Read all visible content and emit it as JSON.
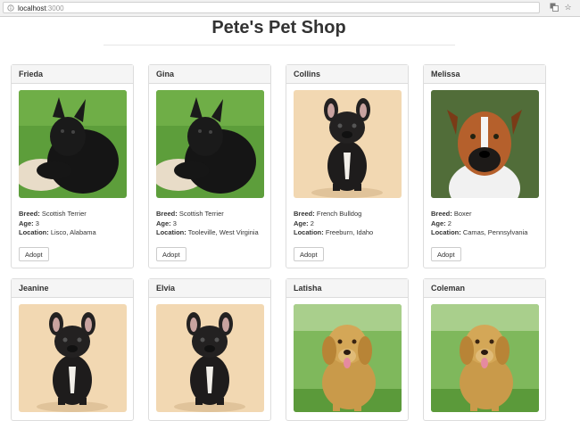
{
  "browser": {
    "url_host": "localhost",
    "url_port": ":3000"
  },
  "page": {
    "title": "Pete's Pet Shop"
  },
  "labels": {
    "breed": "Breed:",
    "age": "Age:",
    "location": "Location:",
    "adopt": "Adopt"
  },
  "pets": [
    {
      "name": "Frieda",
      "breed": "Scottish Terrier",
      "age": "3",
      "location": "Lisco, Alabama",
      "photo": "scottish-terrier"
    },
    {
      "name": "Gina",
      "breed": "Scottish Terrier",
      "age": "3",
      "location": "Tooleville, West Virginia",
      "photo": "scottish-terrier"
    },
    {
      "name": "Collins",
      "breed": "French Bulldog",
      "age": "2",
      "location": "Freeburn, Idaho",
      "photo": "french-bulldog"
    },
    {
      "name": "Melissa",
      "breed": "Boxer",
      "age": "2",
      "location": "Camas, Pennsylvania",
      "photo": "boxer"
    },
    {
      "name": "Jeanine",
      "photo": "french-bulldog"
    },
    {
      "name": "Elvia",
      "photo": "french-bulldog"
    },
    {
      "name": "Latisha",
      "photo": "golden-retriever"
    },
    {
      "name": "Coleman",
      "photo": "golden-retriever"
    }
  ],
  "colors": {
    "panel_border": "#dddddd",
    "panel_heading_bg": "#f5f5f5",
    "text": "#333333"
  }
}
